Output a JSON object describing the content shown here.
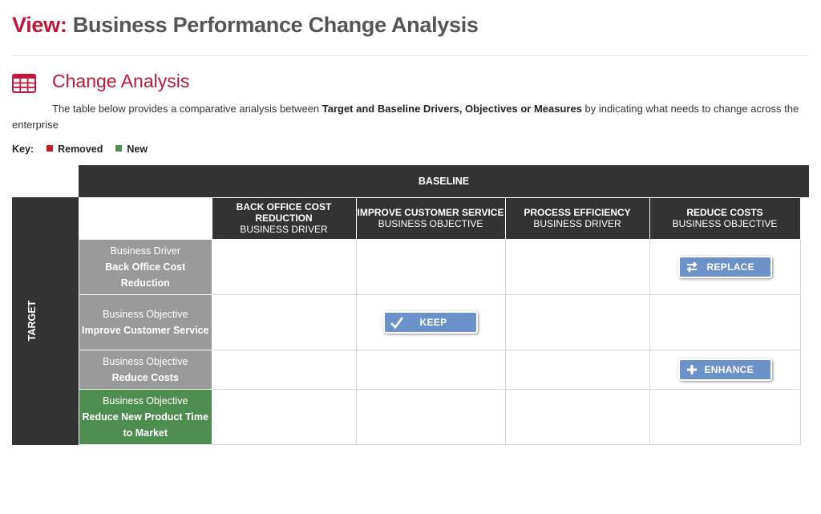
{
  "header": {
    "view_prefix": "View:",
    "title": "Business Performance Change Analysis"
  },
  "section": {
    "icon": "table-icon",
    "title": "Change Analysis",
    "description_pre": "The table below provides a comparative analysis between ",
    "description_bold": "Target and Baseline  Drivers, Objectives or Measures",
    "description_post": " by indicating what needs to change across  the enterprise"
  },
  "key": {
    "label": "Key:",
    "items": [
      {
        "label": "Removed",
        "color": "#c41e2a"
      },
      {
        "label": "New",
        "color": "#4e8d50"
      }
    ]
  },
  "matrix": {
    "baseline_label": "BASELINE",
    "target_label": "TARGET",
    "columns": [
      {
        "title": "BACK OFFICE COST REDUCTION",
        "subtitle": "BUSINESS DRIVER"
      },
      {
        "title": "IMPROVE CUSTOMER SERVICE",
        "subtitle": "BUSINESS OBJECTIVE"
      },
      {
        "title": "PROCESS EFFICIENCY",
        "subtitle": "BUSINESS DRIVER"
      },
      {
        "title": "REDUCE COSTS",
        "subtitle": "BUSINESS OBJECTIVE"
      }
    ],
    "rows": [
      {
        "kind": "Business Driver",
        "name": "Back Office Cost Reduction",
        "status": "existing"
      },
      {
        "kind": "Business Objective",
        "name": "Improve Customer Service",
        "status": "existing"
      },
      {
        "kind": "Business Objective",
        "name": "Reduce Costs",
        "status": "existing"
      },
      {
        "kind": "Business Objective",
        "name": "Reduce New Product Time to Market",
        "status": "new"
      }
    ],
    "actions": [
      {
        "row": 0,
        "col": 3,
        "label": "REPLACE",
        "icon": "swap-arrows-icon"
      },
      {
        "row": 1,
        "col": 1,
        "label": "KEEP",
        "icon": "check-icon"
      },
      {
        "row": 2,
        "col": 3,
        "label": "ENHANCE",
        "icon": "plus-icon"
      }
    ]
  },
  "colors": {
    "accent": "#c0163a",
    "header_dark": "#333333",
    "row_existing": "#9a9a9a",
    "row_new": "#4e8d50",
    "action_button": "#6d92c9"
  }
}
